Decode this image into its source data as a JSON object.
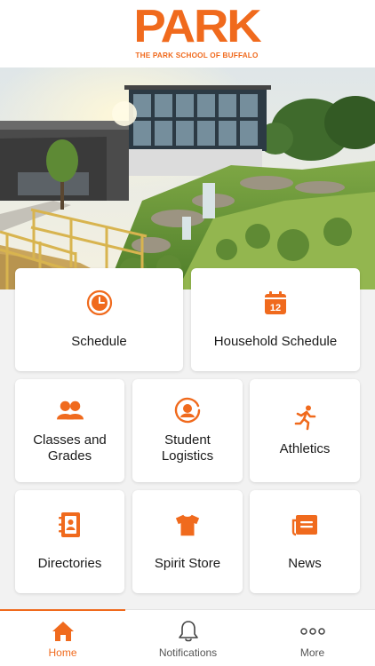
{
  "header": {
    "logo_word": "PARK",
    "logo_subtitle": "THE PARK SCHOOL OF BUFFALO",
    "brand_color": "#f06a1d"
  },
  "tiles": [
    {
      "label": "Schedule",
      "icon": "clock-icon"
    },
    {
      "label": "Household Schedule",
      "icon": "calendar-icon",
      "icon_text": "12"
    },
    {
      "label": "Classes and Grades",
      "icon": "people-icon"
    },
    {
      "label": "Student Logistics",
      "icon": "user-circle-icon"
    },
    {
      "label": "Athletics",
      "icon": "runner-icon"
    },
    {
      "label": "Directories",
      "icon": "address-book-icon"
    },
    {
      "label": "Spirit Store",
      "icon": "tshirt-icon"
    },
    {
      "label": "News",
      "icon": "newspaper-icon"
    }
  ],
  "tabbar": {
    "tabs": [
      {
        "label": "Home",
        "icon": "home-icon",
        "active": true
      },
      {
        "label": "Notifications",
        "icon": "bell-icon",
        "active": false
      },
      {
        "label": "More",
        "icon": "more-dots-icon",
        "active": false
      }
    ]
  }
}
